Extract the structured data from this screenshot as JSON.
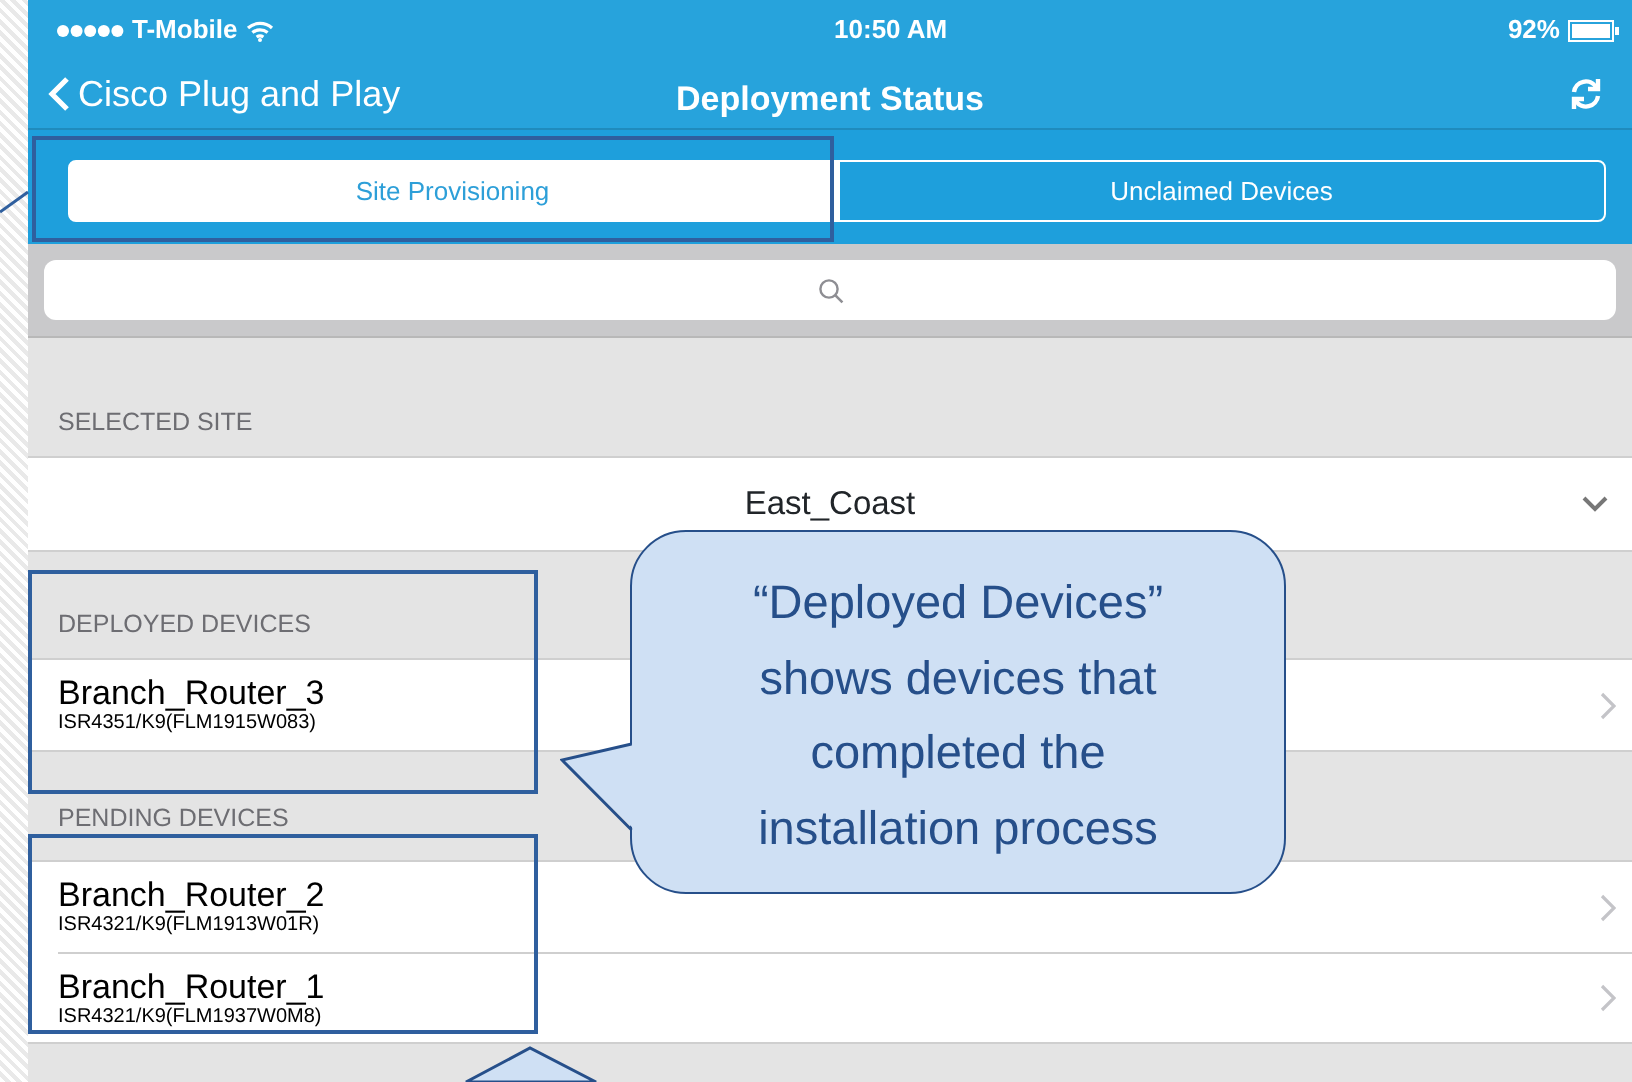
{
  "status_bar": {
    "carrier": "T-Mobile",
    "time": "10:50 AM",
    "battery": "92%"
  },
  "nav": {
    "back_label": "Cisco Plug and Play",
    "title": "Deployment Status"
  },
  "segments": [
    {
      "label": "Site Provisioning",
      "selected": true
    },
    {
      "label": "Unclaimed Devices",
      "selected": false
    }
  ],
  "sections": [
    {
      "kind": "picker",
      "header": "SELECTED SITE",
      "value": "East_Coast"
    },
    {
      "kind": "devices",
      "header": "DEPLOYED DEVICES",
      "rows": [
        {
          "name": "Branch_Router_3",
          "detail": "ISR4351/K9(FLM1915W083)"
        }
      ]
    },
    {
      "kind": "devices",
      "header": "PENDING DEVICES",
      "rows": [
        {
          "name": "Branch_Router_2",
          "detail": "ISR4321/K9(FLM1913W01R)"
        },
        {
          "name": "Branch_Router_1",
          "detail": "ISR4321/K9(FLM1937W0M8)"
        }
      ]
    }
  ],
  "callout": {
    "text": "“Deployed Devices” shows devices that completed the installation process"
  }
}
